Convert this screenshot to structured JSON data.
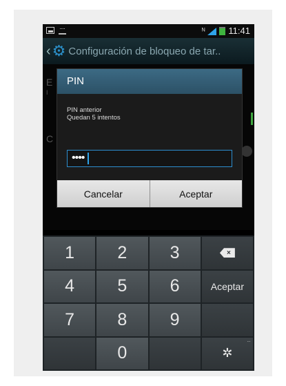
{
  "status_bar": {
    "time": "11:41",
    "mute_icon": "mute-icon"
  },
  "action_bar": {
    "back_icon": "back-icon",
    "app_icon": "gear-icon",
    "title": "Configuración de bloqueo de tar.."
  },
  "dialog": {
    "title": "PIN",
    "message_line1": "PIN anterior",
    "message_line2": "Quedan 5 intentos",
    "pin_value": "••••",
    "cancel_label": "Cancelar",
    "accept_label": "Aceptar"
  },
  "keypad": {
    "keys": [
      "1",
      "2",
      "3",
      "4",
      "5",
      "6",
      "7",
      "8",
      "9",
      "0"
    ],
    "backspace_label": "×",
    "accept_label": "Aceptar",
    "more_dots": "···",
    "settings_icon": "settings-icon"
  },
  "colors": {
    "accent": "#2d8fd0",
    "dialog_title_bg": "#3c6a84",
    "key_bg": "#4a5155"
  }
}
